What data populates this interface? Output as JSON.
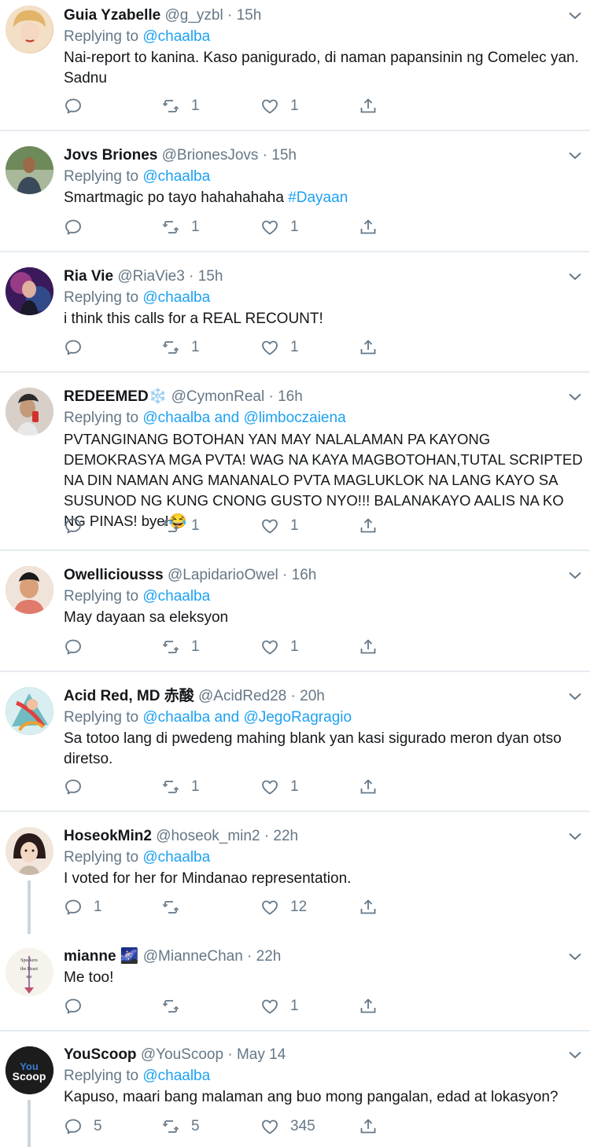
{
  "tweets": [
    {
      "name": "Guia Yzabelle",
      "handle": "@g_yzbl",
      "time": "15h",
      "replying_prefix": "Replying to",
      "replying_to": "@chaalba",
      "replying_and": "",
      "replying_to2": "",
      "text": "Nai-report to kanina. Kaso panigurado, di naman papansinin ng Comelec yan. Sadnu",
      "replies": "",
      "retweets": "1",
      "likes": "1",
      "avatar_color": "#e9c9a8"
    },
    {
      "name": "Jovs Briones",
      "handle": "@BrionesJovs",
      "time": "15h",
      "replying_prefix": "Replying to",
      "replying_to": "@chaalba",
      "replying_and": "",
      "replying_to2": "",
      "text": "Smartmagic po tayo hahahahaha",
      "hashtag": "#Dayaan",
      "replies": "",
      "retweets": "1",
      "likes": "1",
      "avatar_color": "#7a8a6a"
    },
    {
      "name": "Ria Vie",
      "handle": "@RiaVie3",
      "time": "15h",
      "replying_prefix": "Replying to",
      "replying_to": "@chaalba",
      "replying_and": "",
      "replying_to2": "",
      "text": "i think this calls for a REAL RECOUNT!",
      "replies": "",
      "retweets": "1",
      "likes": "1",
      "avatar_color": "#5a2a7a"
    },
    {
      "name": "REDEEMED❄️",
      "handle": "@CymonReal",
      "time": "16h",
      "replying_prefix": "Replying to",
      "replying_to": "@chaalba",
      "replying_and": "and",
      "replying_to2": "@limboczaiena",
      "text": "PVTANGINANG BOTOHAN YAN MAY NALALAMAN PA KAYONG DEMOKRASYA MGA PVTA! WAG NA KAYA MAGBOTOHAN,TUTAL SCRIPTED NA DIN NAMAN ANG MANANALO PVTA MAGLUKLOK NA LANG KAYO SA SUSUNOD NG KUNG CNONG GUSTO NYO!!! BALANAKAYO AALIS NA KO NG PINAS! bye!😂",
      "replies": "",
      "retweets": "1",
      "likes": "1",
      "avatar_color": "#c8b8a8"
    },
    {
      "name": "Owelliciousss",
      "handle": "@LapidarioOwel",
      "time": "16h",
      "replying_prefix": "Replying to",
      "replying_to": "@chaalba",
      "replying_and": "",
      "replying_to2": "",
      "text": "May dayaan sa eleksyon",
      "replies": "",
      "retweets": "1",
      "likes": "1",
      "avatar_color": "#c98a6a"
    },
    {
      "name": "Acid Red, MD 赤酸",
      "handle": "@AcidRed28",
      "time": "20h",
      "replying_prefix": "Replying to",
      "replying_to": "@chaalba",
      "replying_and": "and",
      "replying_to2": "@JegoRagragio",
      "text": "Sa totoo lang di pwedeng mahing blank yan kasi sigurado meron dyan otso diretso.",
      "replies": "",
      "retweets": "1",
      "likes": "1",
      "avatar_color": "#4a9a9a"
    },
    {
      "name": "HoseokMin2",
      "handle": "@hoseok_min2",
      "time": "22h",
      "replying_prefix": "Replying to",
      "replying_to": "@chaalba",
      "replying_and": "",
      "replying_to2": "",
      "text": "I voted for her for Mindanao representation.",
      "replies": "1",
      "retweets": "",
      "likes": "12",
      "avatar_color": "#e8d0c0"
    },
    {
      "name": "mianne 🌌",
      "handle": "@MianneChan",
      "time": "22h",
      "replying_prefix": "",
      "replying_to": "",
      "replying_and": "",
      "replying_to2": "",
      "text": "Me too!",
      "replies": "",
      "retweets": "",
      "likes": "1",
      "avatar_color": "#f4f0ea"
    },
    {
      "name": "YouScoop",
      "handle": "@YouScoop",
      "time": "May 14",
      "replying_prefix": "Replying to",
      "replying_to": "@chaalba",
      "replying_and": "",
      "replying_to2": "",
      "text": "Kapuso, maari bang malaman ang buo mong pangalan, edad at lokasyon?",
      "replies": "5",
      "retweets": "5",
      "likes": "345",
      "avatar_color": "#1a1a1a"
    }
  ],
  "avatar_texts": {
    "mianne": "Speakers ... the Heart ... me",
    "youscoop_top": "You",
    "youscoop_bottom": "Scoop"
  },
  "colors": {
    "link": "#1da1f2",
    "muted": "#657786",
    "separator": "#e6ecf0"
  },
  "icons": {
    "reply": "reply-icon",
    "retweet": "retweet-icon",
    "like": "heart-icon",
    "share": "share-icon",
    "menu": "chevron-down-icon"
  }
}
